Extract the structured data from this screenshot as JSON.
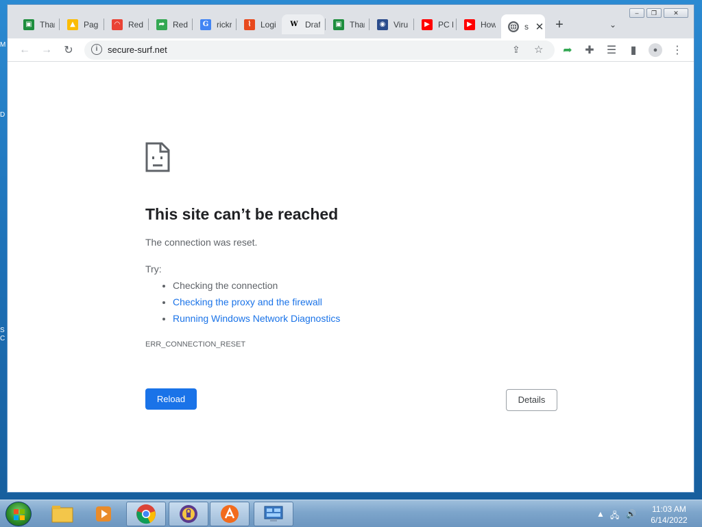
{
  "browser": {
    "tabs": [
      {
        "label": "Thar",
        "icon": "sheets-icon",
        "color": "#1e8e3e"
      },
      {
        "label": "Page",
        "icon": "drive-icon",
        "color": "#fbbc04"
      },
      {
        "label": "Redi",
        "icon": "rainbow-icon",
        "color": "#ea4335"
      },
      {
        "label": "Redi",
        "icon": "forward-arrow-icon",
        "color": "#34a853"
      },
      {
        "label": "rickr",
        "icon": "google-icon",
        "color": "#4285f4"
      },
      {
        "label": "Logi",
        "icon": "zoho-icon",
        "color": "#e8491d"
      },
      {
        "label": "Draf",
        "icon": "wikipedia-icon",
        "color": "#000000"
      },
      {
        "label": "Thar",
        "icon": "sheets-icon",
        "color": "#1e8e3e"
      },
      {
        "label": "Viru",
        "icon": "virus-icon",
        "color": "#2b4c8c"
      },
      {
        "label": "PC F",
        "icon": "youtube-icon",
        "color": "#ff0000"
      },
      {
        "label": "How",
        "icon": "youtube-icon",
        "color": "#ff0000"
      }
    ],
    "active_tab": {
      "label": "s",
      "icon": "globe-icon"
    },
    "new_tab_label": "+",
    "url": "secure-surf.net"
  },
  "page": {
    "title": "This site can’t be reached",
    "subtitle": "The connection was reset.",
    "try_label": "Try:",
    "suggestions": [
      {
        "text": "Checking the connection",
        "link": false
      },
      {
        "text": "Checking the proxy and the firewall",
        "link": true
      },
      {
        "text": "Running Windows Network Diagnostics",
        "link": true
      }
    ],
    "error_code": "ERR_CONNECTION_RESET",
    "reload_label": "Reload",
    "details_label": "Details"
  },
  "taskbar": {
    "time": "11:03 AM",
    "date": "6/14/2022"
  },
  "colors": {
    "accent": "#1a73e8",
    "text_secondary": "#5f6368"
  }
}
